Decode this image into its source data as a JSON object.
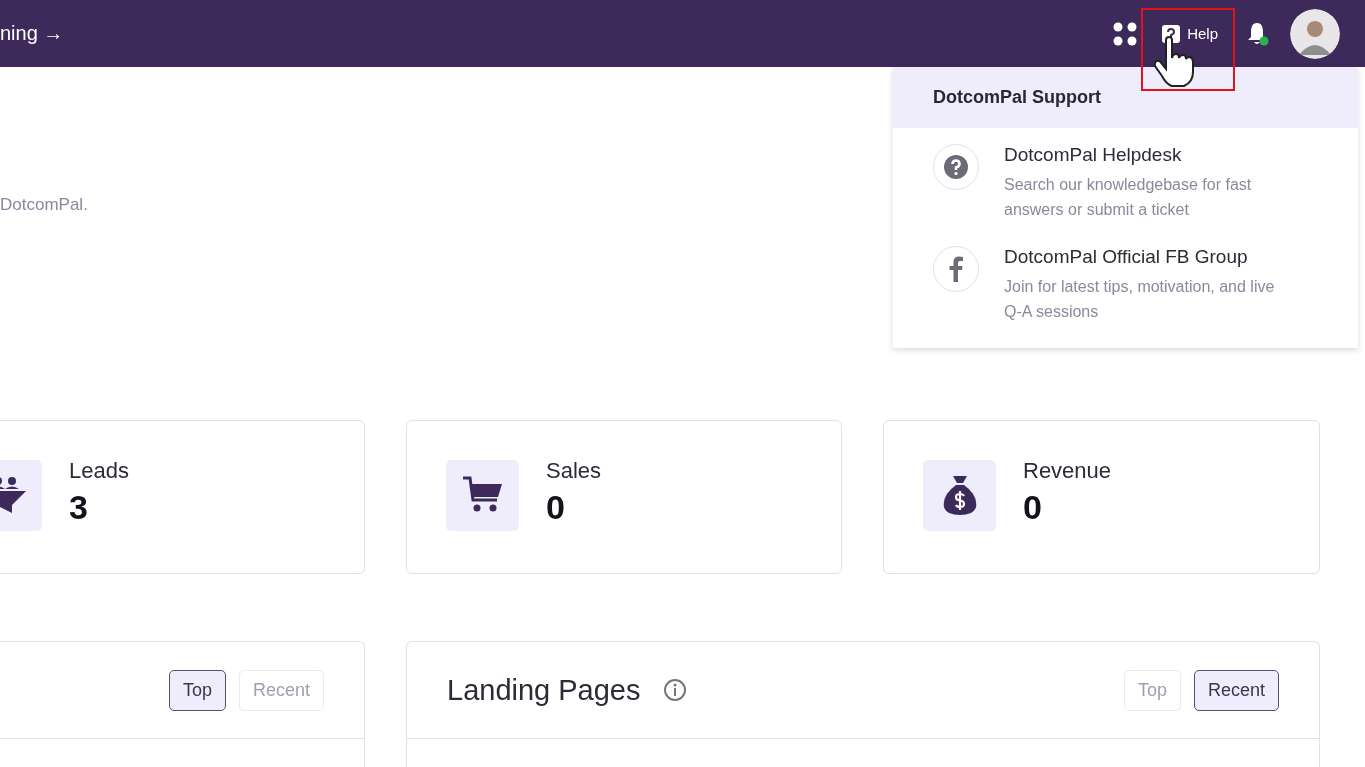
{
  "topbar": {
    "link": "ning →",
    "help_label": "Help",
    "notification_dot": true
  },
  "intro": {
    "text": "DotcomPal."
  },
  "stats": [
    {
      "kind": "leads",
      "label": "Leads",
      "value": "3"
    },
    {
      "kind": "sales",
      "label": "Sales",
      "value": "0"
    },
    {
      "kind": "revenue",
      "label": "Revenue",
      "value": "0"
    }
  ],
  "panels": [
    {
      "tabs": [
        {
          "label": "Top",
          "selected": true
        },
        {
          "label": "Recent",
          "selected": false
        }
      ]
    },
    {
      "title": "Landing Pages",
      "tabs": [
        {
          "label": "Top",
          "selected": false
        },
        {
          "label": "Recent",
          "selected": true
        }
      ]
    }
  ],
  "support_menu": {
    "title": "DotcomPal Support",
    "items": [
      {
        "kind": "help",
        "title": "DotcomPal Helpdesk",
        "description": "Search our knowledgebase for fast answers or submit a ticket"
      },
      {
        "kind": "facebook",
        "title": "DotcomPal Official FB Group",
        "description": "Join for latest tips, motivation, and live Q-A sessions"
      }
    ]
  }
}
